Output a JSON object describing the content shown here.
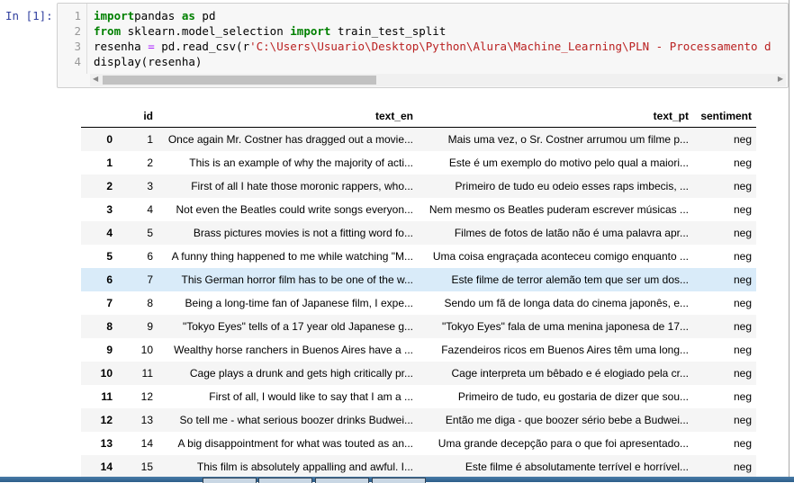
{
  "cell": {
    "prompt": "In [1]:",
    "lines": [
      {
        "num": "1",
        "parts": [
          [
            "kw",
            "import"
          ],
          [
            "",
            "pandas "
          ],
          [
            "kw",
            "as"
          ],
          [
            "",
            " pd"
          ]
        ]
      },
      {
        "num": "2",
        "parts": [
          [
            "kw",
            "from"
          ],
          [
            "",
            " sklearn.model_selection "
          ],
          [
            "kw",
            "import"
          ],
          [
            "",
            " train_test_split"
          ]
        ]
      },
      {
        "num": "3",
        "parts": [
          [
            "",
            "resenha "
          ],
          [
            "op",
            "="
          ],
          [
            "",
            " pd.read_csv(r"
          ],
          [
            "str",
            "'C:\\Users\\Usuario\\Desktop\\Python\\Alura\\Machine_Learning\\PLN - Processamento d"
          ]
        ]
      },
      {
        "num": "4",
        "parts": [
          [
            "",
            "display(resenha)"
          ]
        ]
      }
    ]
  },
  "table": {
    "columns": [
      "",
      "id",
      "text_en",
      "text_pt",
      "sentiment"
    ],
    "highlighted_row": 6,
    "rows": [
      [
        "0",
        "1",
        "Once again Mr. Costner has dragged out a movie...",
        "Mais uma vez, o Sr. Costner arrumou um filme p...",
        "neg"
      ],
      [
        "1",
        "2",
        "This is an example of why the majority of acti...",
        "Este é um exemplo do motivo pelo qual a maiori...",
        "neg"
      ],
      [
        "2",
        "3",
        "First of all I hate those moronic rappers, who...",
        "Primeiro de tudo eu odeio esses raps imbecis, ...",
        "neg"
      ],
      [
        "3",
        "4",
        "Not even the Beatles could write songs everyon...",
        "Nem mesmo os Beatles puderam escrever músicas ...",
        "neg"
      ],
      [
        "4",
        "5",
        "Brass pictures movies is not a fitting word fo...",
        "Filmes de fotos de latão não é uma palavra apr...",
        "neg"
      ],
      [
        "5",
        "6",
        "A funny thing happened to me while watching \"M...",
        "Uma coisa engraçada aconteceu comigo enquanto ...",
        "neg"
      ],
      [
        "6",
        "7",
        "This German horror film has to be one of the w...",
        "Este filme de terror alemão tem que ser um dos...",
        "neg"
      ],
      [
        "7",
        "8",
        "Being a long-time fan of Japanese film, I expe...",
        "Sendo um fã de longa data do cinema japonês, e...",
        "neg"
      ],
      [
        "8",
        "9",
        "\"Tokyo Eyes\" tells of a 17 year old Japanese g...",
        "\"Tokyo Eyes\" fala de uma menina japonesa de 17...",
        "neg"
      ],
      [
        "9",
        "10",
        "Wealthy horse ranchers in Buenos Aires have a ...",
        "Fazendeiros ricos em Buenos Aires têm uma long...",
        "neg"
      ],
      [
        "10",
        "11",
        "Cage plays a drunk and gets high critically pr...",
        "Cage interpreta um bêbado e é elogiado pela cr...",
        "neg"
      ],
      [
        "11",
        "12",
        "First of all, I would like to say that I am a ...",
        "Primeiro de tudo, eu gostaria de dizer que sou...",
        "neg"
      ],
      [
        "12",
        "13",
        "So tell me - what serious boozer drinks Budwei...",
        "Então me diga - que boozer sério bebe a Budwei...",
        "neg"
      ],
      [
        "13",
        "14",
        "A big disappointment for what was touted as an...",
        "Uma grande decepção para o que foi apresentado...",
        "neg"
      ],
      [
        "14",
        "15",
        "This film is absolutely appalling and awful. I...",
        "Este filme é absolutamente terrível e horrível...",
        "neg"
      ]
    ]
  },
  "colors": {
    "prompt": "#303f9f",
    "keyword": "#008000",
    "string": "#ba2121",
    "highlight": "#d9ebf9"
  }
}
